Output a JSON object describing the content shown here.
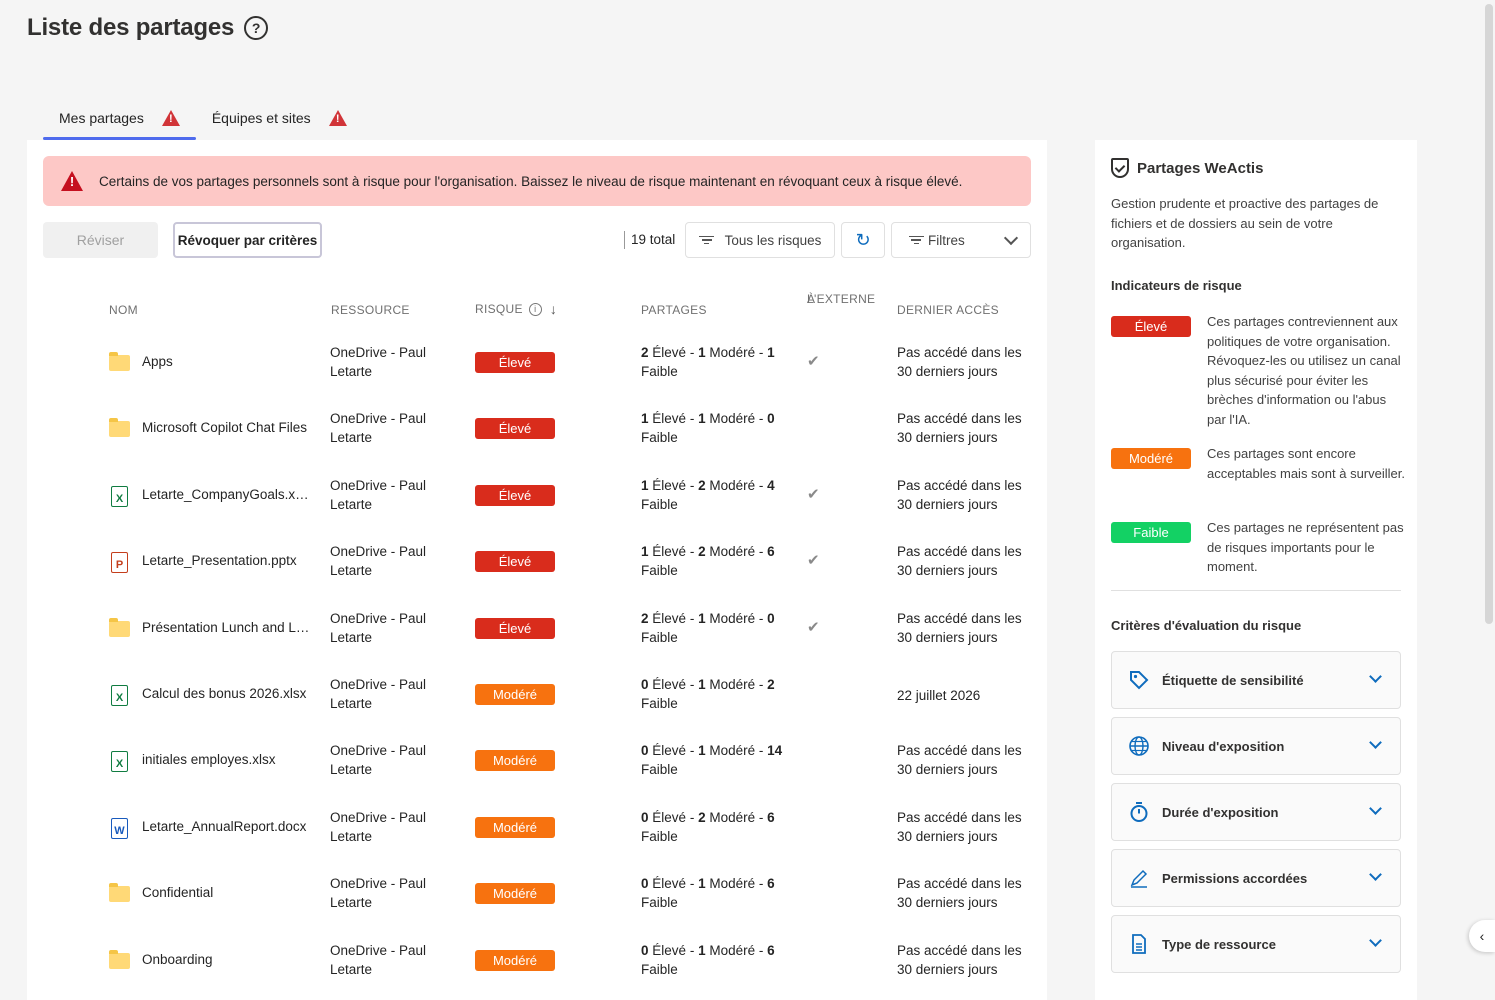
{
  "page": {
    "title": "Liste des partages"
  },
  "tabs": [
    {
      "label": "Mes partages",
      "active": true
    },
    {
      "label": "Équipes et sites",
      "active": false
    }
  ],
  "alert": {
    "text": "Certains de vos partages personnels sont à risque pour l'organisation. Baissez le niveau de risque maintenant en révoquant ceux à risque élevé."
  },
  "toolbar": {
    "review_label": "Réviser",
    "revoke_label": "Révoquer par critères",
    "total": "19 total",
    "risk_filter": "Tous les risques",
    "filters": "Filtres"
  },
  "columns": {
    "name": "NOM",
    "resource": "RESSOURCE",
    "risk": "RISQUE",
    "shares": "PARTAGES",
    "external_1": "À",
    "external_2": "L'EXTERNE",
    "last_access": "DERNIER ACCÈS"
  },
  "colors": {
    "eleve": "#d92c1c",
    "modere": "#f7720f",
    "faible": "#13d164"
  },
  "rows": [
    {
      "icon": "folder",
      "name": "Apps",
      "resource": "OneDrive - Paul Letarte",
      "risk": "Élevé",
      "risk_level": "eleve",
      "s1": "2",
      "s2": "1",
      "s3": "1",
      "external": true,
      "access": "Pas accédé dans les 30 derniers jours"
    },
    {
      "icon": "folder",
      "name": "Microsoft Copilot Chat Files",
      "resource": "OneDrive - Paul Letarte",
      "risk": "Élevé",
      "risk_level": "eleve",
      "s1": "1",
      "s2": "1",
      "s3": "0",
      "external": false,
      "access": "Pas accédé dans les 30 derniers jours"
    },
    {
      "icon": "xlsx",
      "name": "Letarte_CompanyGoals.xlsx",
      "resource": "OneDrive - Paul Letarte",
      "risk": "Élevé",
      "risk_level": "eleve",
      "s1": "1",
      "s2": "2",
      "s3": "4",
      "external": true,
      "access": "Pas accédé dans les 30 derniers jours"
    },
    {
      "icon": "pptx",
      "name": "Letarte_Presentation.pptx",
      "resource": "OneDrive - Paul Letarte",
      "risk": "Élevé",
      "risk_level": "eleve",
      "s1": "1",
      "s2": "2",
      "s3": "6",
      "external": true,
      "access": "Pas accédé dans les 30 derniers jours"
    },
    {
      "icon": "folder",
      "name": "Présentation Lunch and Learn",
      "resource": "OneDrive - Paul Letarte",
      "risk": "Élevé",
      "risk_level": "eleve",
      "s1": "2",
      "s2": "1",
      "s3": "0",
      "external": true,
      "access": "Pas accédé dans les 30 derniers jours"
    },
    {
      "icon": "xlsx",
      "name": "Calcul des bonus 2026.xlsx",
      "resource": "OneDrive - Paul Letarte",
      "risk": "Modéré",
      "risk_level": "modere",
      "s1": "0",
      "s2": "1",
      "s3": "2",
      "external": false,
      "access": "22 juillet 2026"
    },
    {
      "icon": "xlsx",
      "name": "initiales employes.xlsx",
      "resource": "OneDrive - Paul Letarte",
      "risk": "Modéré",
      "risk_level": "modere",
      "s1": "0",
      "s2": "1",
      "s3": "14",
      "external": false,
      "access": "Pas accédé dans les 30 derniers jours"
    },
    {
      "icon": "docx",
      "name": "Letarte_AnnualReport.docx",
      "resource": "OneDrive - Paul Letarte",
      "risk": "Modéré",
      "risk_level": "modere",
      "s1": "0",
      "s2": "2",
      "s3": "6",
      "external": false,
      "access": "Pas accédé dans les 30 derniers jours"
    },
    {
      "icon": "folder",
      "name": "Confidential",
      "resource": "OneDrive - Paul Letarte",
      "risk": "Modéré",
      "risk_level": "modere",
      "s1": "0",
      "s2": "1",
      "s3": "6",
      "external": false,
      "access": "Pas accédé dans les 30 derniers jours"
    },
    {
      "icon": "folder",
      "name": "Onboarding",
      "resource": "OneDrive - Paul Letarte",
      "risk": "Modéré",
      "risk_level": "modere",
      "s1": "0",
      "s2": "1",
      "s3": "6",
      "external": false,
      "access": "Pas accédé dans les 30 derniers jours"
    }
  ],
  "share_words": {
    "high": "Élevé",
    "mid": "Modéré",
    "low": "Faible"
  },
  "side": {
    "title": "Partages WeActis",
    "description": "Gestion prudente et proactive des partages de fichiers et de dossiers au sein de votre organisation.",
    "indicators_title": "Indicateurs de risque",
    "indicators": [
      {
        "label": "Élevé",
        "level": "eleve",
        "text": "Ces partages contreviennent aux politiques de votre organisation. Révoquez-les ou utilisez un canal plus sécurisé pour éviter les brèches d'information ou l'abus par l'IA."
      },
      {
        "label": "Modéré",
        "level": "modere",
        "text": "Ces partages sont encore acceptables mais sont à surveiller."
      },
      {
        "label": "Faible",
        "level": "faible",
        "text": "Ces partages ne représentent pas de risques importants pour le moment."
      }
    ],
    "criteria_title": "Critères d'évaluation du risque",
    "criteria": [
      {
        "label": "Étiquette de sensibilité",
        "icon": "tag-icon"
      },
      {
        "label": "Niveau d'exposition",
        "icon": "globe-icon"
      },
      {
        "label": "Durée d'exposition",
        "icon": "timer-icon"
      },
      {
        "label": "Permissions accordées",
        "icon": "pen-icon"
      },
      {
        "label": "Type de ressource",
        "icon": "document-icon"
      }
    ]
  }
}
